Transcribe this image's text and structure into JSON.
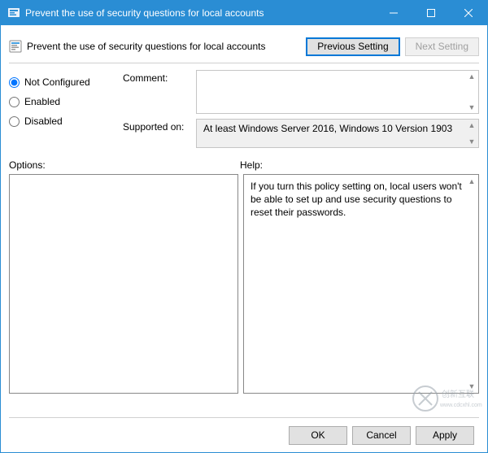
{
  "window": {
    "title": "Prevent the use of security questions for local accounts"
  },
  "header": {
    "policy_title": "Prevent the use of security questions for local accounts",
    "previous_btn": "Previous Setting",
    "next_btn": "Next Setting"
  },
  "state": {
    "not_configured": "Not Configured",
    "enabled": "Enabled",
    "disabled": "Disabled",
    "selected": "not_configured"
  },
  "fields": {
    "comment_label": "Comment:",
    "comment_value": "",
    "supported_label": "Supported on:",
    "supported_value": "At least Windows Server 2016, Windows 10 Version 1903"
  },
  "panels": {
    "options_label": "Options:",
    "help_label": "Help:",
    "help_text": "If you turn this policy setting on, local users won't be able to set up and use security questions to reset their passwords."
  },
  "footer": {
    "ok": "OK",
    "cancel": "Cancel",
    "apply": "Apply"
  }
}
